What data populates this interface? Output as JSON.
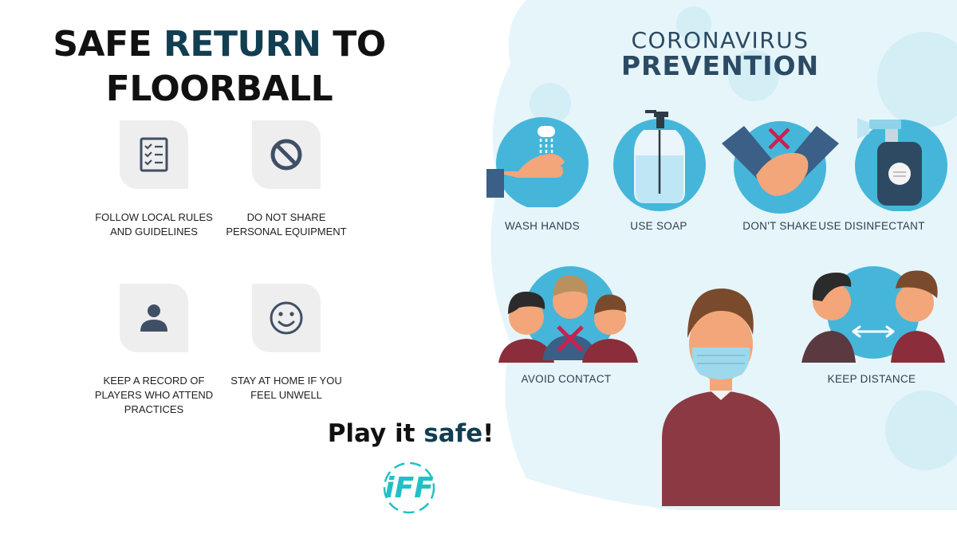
{
  "left": {
    "title_line1_a": "SAFE ",
    "title_line1_b": "RETURN",
    "title_line1_c": " TO",
    "title_line2": "FLOORBALL",
    "items": [
      {
        "label": "FOLLOW LOCAL RULES AND GUIDELINES",
        "icon": "checklist-icon"
      },
      {
        "label": "DO NOT SHARE PERSONAL EQUIPMENT",
        "icon": "prohibited-icon"
      },
      {
        "label": "KEEP A RECORD OF PLAYERS WHO ATTEND PRACTICES",
        "icon": "person-icon"
      },
      {
        "label": "STAY AT HOME IF YOU FEEL UNWELL",
        "icon": "smiley-icon"
      }
    ],
    "tagline_a": "Play it ",
    "tagline_b": "safe",
    "tagline_c": "!",
    "logo_text": "iFF"
  },
  "right": {
    "title_line1": "CORONAVIRUS",
    "title_line2": "PREVENTION",
    "labels": {
      "wash": "WASH HANDS",
      "soap": "USE SOAP",
      "shake": "DON'T SHAKE",
      "disinfect": "USE DISINFECTANT",
      "contact": "AVOID CONTACT",
      "distance": "KEEP DISTANCE"
    }
  },
  "colors": {
    "accent_dark": "#123e52",
    "circle_blue": "#45b6da",
    "bg_blue": "#dff2f8",
    "logo_teal": "#1fc1c6",
    "cross_red": "#c9214f"
  }
}
